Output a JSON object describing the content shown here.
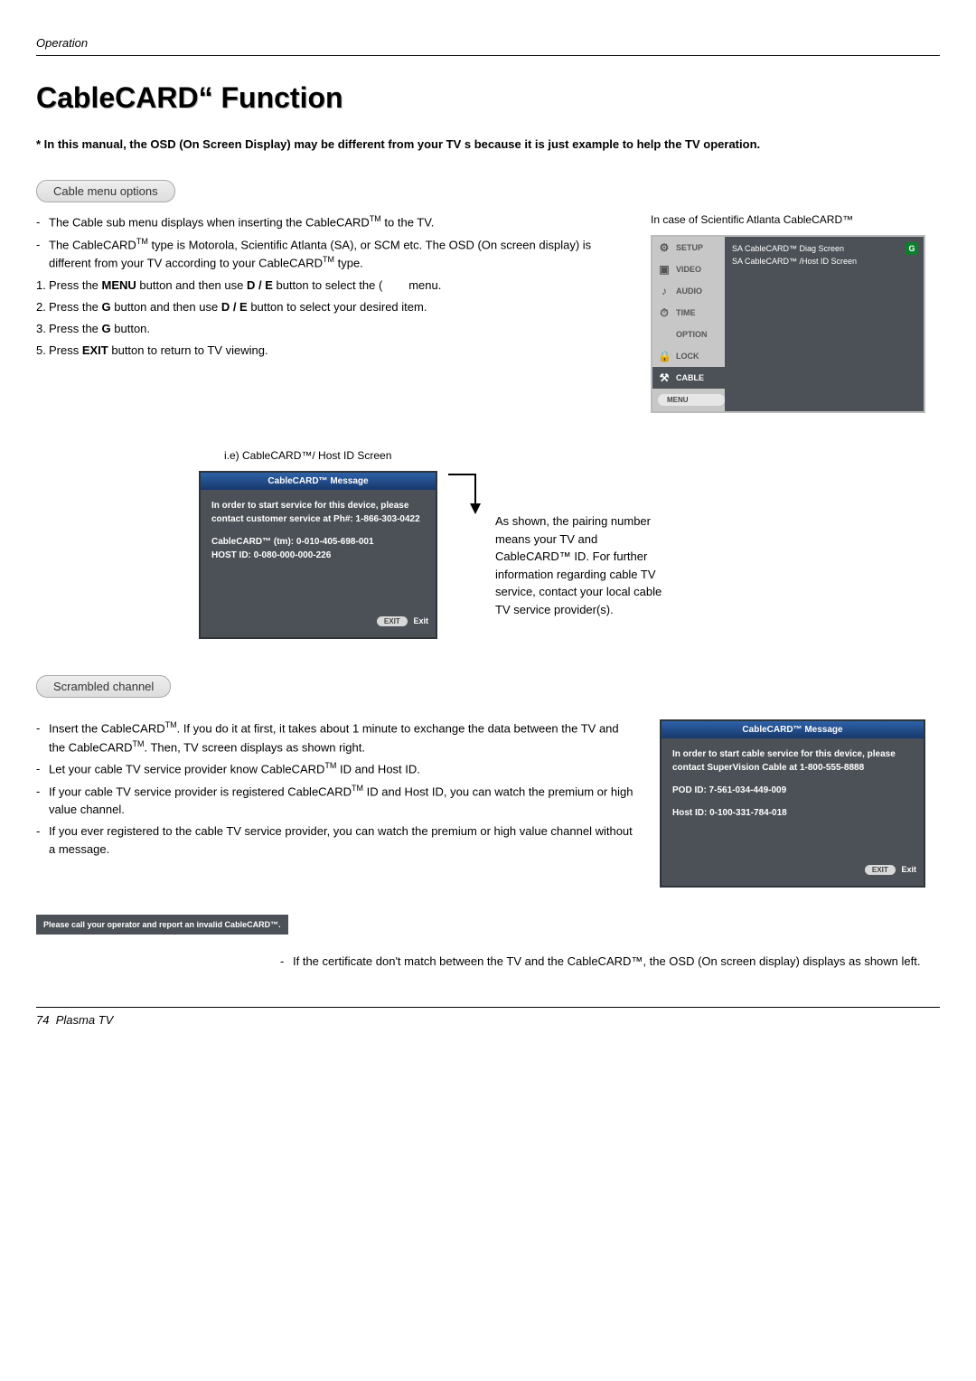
{
  "header": {
    "section": "Operation"
  },
  "title": "CableCARD“   Function",
  "disclaimer": "* In this manual, the OSD (On Screen Display) may be different from your TV s because it is just example to help the TV operation.",
  "cable_menu": {
    "label": "Cable menu options",
    "b1": "The Cable sub menu displays when inserting the CableCARD",
    "b1b": " to the TV.",
    "b2a": "The CableCARD",
    "b2b": " type is Motorola, Scientific Atlanta (SA), or SCM etc. The OSD (On screen display) is different from your TV according to your CableCARD",
    "b2c": " type.",
    "s1a": "Press the ",
    "s1b": "MENU",
    "s1c": " button and then use ",
    "s1d": "D  / E",
    "s1e": "  button to select the   (",
    "s1f": "menu.",
    "s2a": "Press the ",
    "s2b": "G",
    "s2c": "  button and then use ",
    "s2d": "D  / E",
    "s2e": "  button to select your desired item.",
    "s3a": "Press the ",
    "s3b": "G",
    "s3c": "  button.",
    "s5a": "Press ",
    "s5b": "EXIT",
    "s5c": " button to return to TV viewing.",
    "right_caption": "In case of Scientific Atlanta CableCARD™"
  },
  "osd": {
    "items": [
      "SETUP",
      "VIDEO",
      "AUDIO",
      "TIME",
      "OPTION",
      "LOCK",
      "CABLE"
    ],
    "icons": [
      "⚙",
      "▣",
      "♪",
      "⏱",
      "",
      "🔒",
      "⚒"
    ],
    "g": "G",
    "line1": "SA CableCARD™   Diag Screen",
    "line2": "SA CableCARD™  /Host ID Screen",
    "menu": "MENU"
  },
  "ie": {
    "title": "i.e) CableCARD™/ Host ID Screen",
    "hdr": "CableCARD™   Message",
    "p1": "In order to start service for this device, please contact customer service at Ph#: 1-866-303-0422",
    "p2": "CableCARD™  (tm): 0-010-405-698-001",
    "p3": "HOST ID: 0-080-000-000-226",
    "exit_btn": "EXIT",
    "exit_lbl": "Exit",
    "pair": "As shown, the pairing number means your TV and CableCARD™ ID. For further information regarding cable TV service, contact your local cable TV service provider(s)."
  },
  "scrambled": {
    "label": "Scrambled channel",
    "l1a": "Insert the CableCARD",
    "l1b": ". If you do it at first, it takes about 1 minute to exchange the data between the TV and the CableCARD",
    "l1c": ". Then, TV screen displays as shown right.",
    "l2a": "Let your cable TV service provider know CableCARD",
    "l2b": " ID and Host ID.",
    "l3a": "If your cable TV service provider is registered CableCARD",
    "l3b": " ID and Host ID, you can watch the premium or high value channel.",
    "l4": "If you ever registered to the cable TV service provider, you can watch the premium or high value channel without a message.",
    "msg_hdr": "CableCARD™   Message",
    "msg_p1": "In order to start cable service for this device, please contact SuperVision Cable at 1-800-555-8888",
    "msg_p2": "POD ID: 7-561-034-449-009",
    "msg_p3": "Host ID: 0-100-331-784-018",
    "exit_btn": "EXIT",
    "exit_lbl": "Exit"
  },
  "invalid": {
    "strip": "Please call your operator and report an invalid CableCARD™.",
    "caption": "If the certificate don't match between the TV and the CableCARD™, the OSD (On screen display) displays as shown left."
  },
  "footer": {
    "page": "74",
    "product": "Plasma TV"
  }
}
